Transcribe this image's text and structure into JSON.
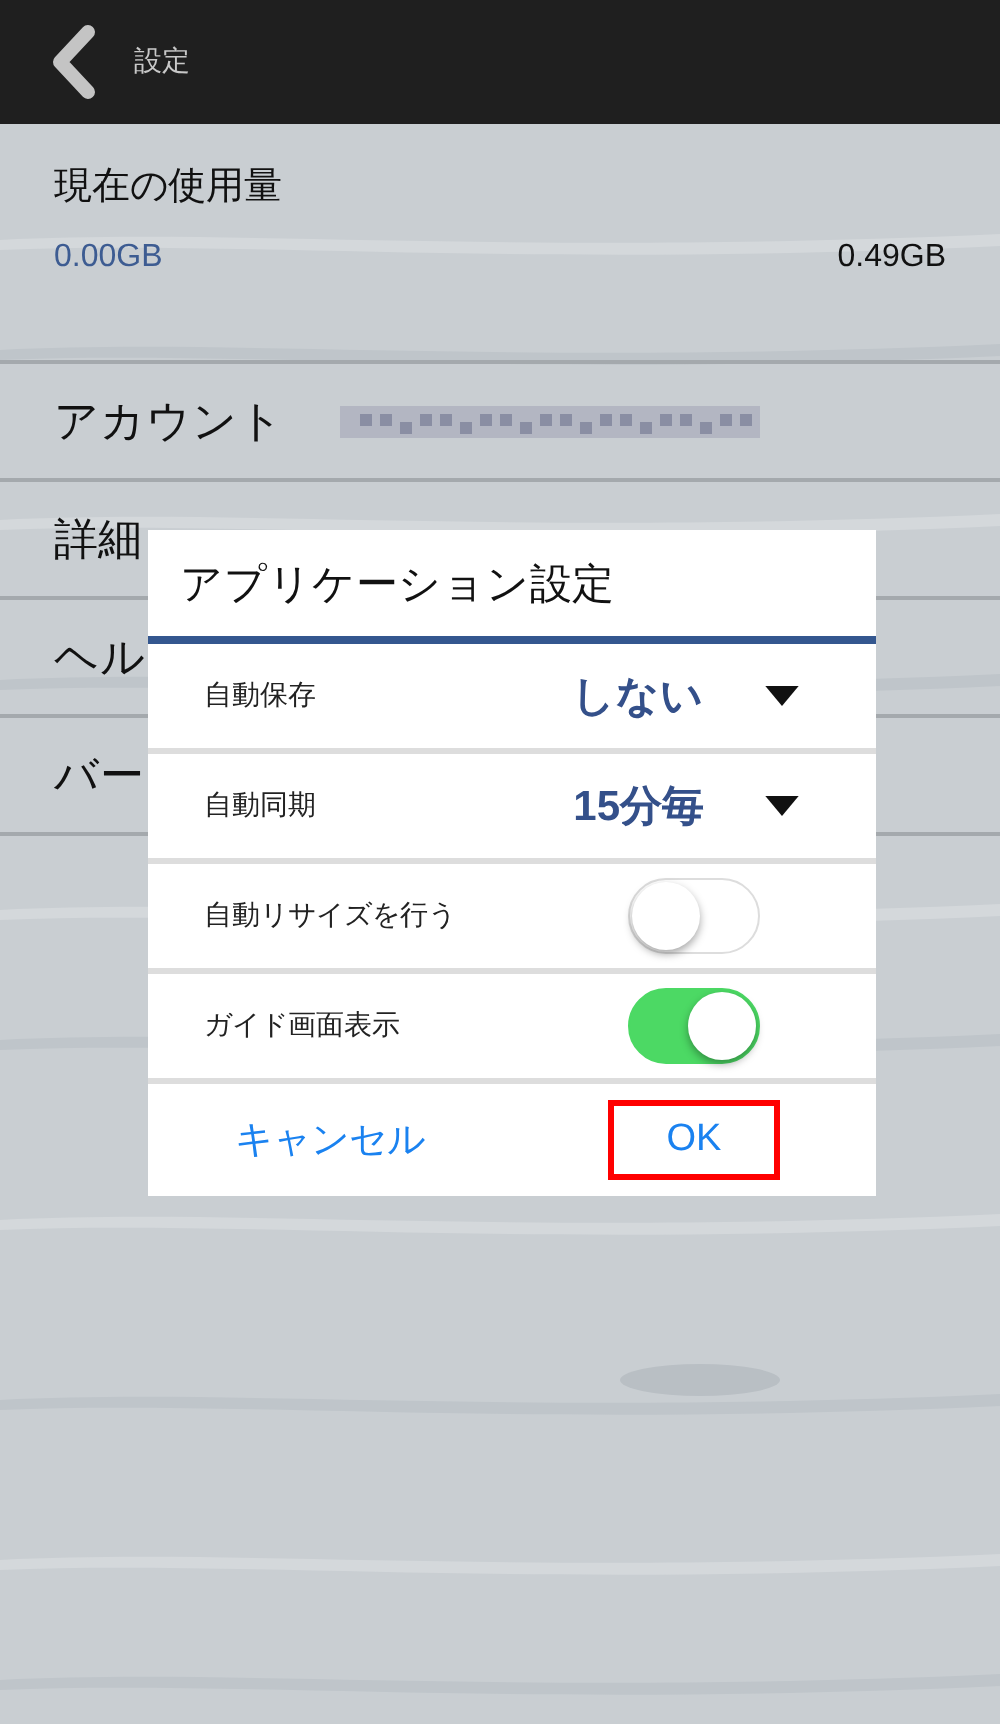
{
  "header": {
    "title": "設定"
  },
  "usage": {
    "title": "現在の使用量",
    "used": "0.00GB",
    "total": "0.49GB"
  },
  "rows": [
    {
      "label": "アカウント",
      "kind": "account"
    },
    {
      "label": "詳細",
      "kind": "plain"
    },
    {
      "label": "ヘル",
      "kind": "plain"
    },
    {
      "label": "バー",
      "kind": "plain"
    }
  ],
  "dialog": {
    "title": "アプリケーション設定",
    "settings": [
      {
        "label": "自動保存",
        "kind": "select",
        "value": "しない"
      },
      {
        "label": "自動同期",
        "kind": "select",
        "value": "15分毎"
      },
      {
        "label": "自動リサイズを行う",
        "kind": "toggle",
        "on": false
      },
      {
        "label": "ガイド画面表示",
        "kind": "toggle",
        "on": true
      }
    ],
    "buttons": [
      {
        "label": "キャンセル",
        "highlighted": false
      },
      {
        "label": "OK",
        "highlighted": true
      }
    ]
  }
}
